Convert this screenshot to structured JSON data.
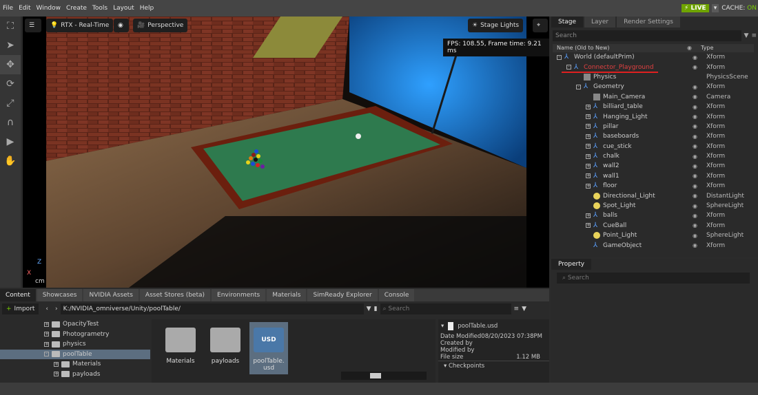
{
  "menu": [
    "File",
    "Edit",
    "Window",
    "Create",
    "Tools",
    "Layout",
    "Help"
  ],
  "live_label": "LIVE",
  "cache_prefix": "CACHE:",
  "cache_state": "ON",
  "viewport": {
    "render_mode": "RTX - Real-Time",
    "camera": "Perspective",
    "lights": "Stage Lights",
    "fps_text": "FPS: 108.55, Frame time: 9.21 ms",
    "units": "cm",
    "axis_x": "X",
    "axis_z": "Z"
  },
  "stage": {
    "tabs": [
      "Stage",
      "Layer",
      "Render Settings"
    ],
    "search_placeholder": "Search",
    "col_name": "Name (Old to New)",
    "col_type": "Type",
    "rows": [
      {
        "name": "World (defaultPrim)",
        "type": "Xform",
        "indent": 0,
        "icon": "xform-icon",
        "exp": "-",
        "eye": true
      },
      {
        "name": "Connector_Playground",
        "type": "Xform",
        "indent": 1,
        "icon": "xform-icon",
        "exp": "-",
        "eye": true
      },
      {
        "name": "Physics",
        "type": "PhysicsScene",
        "indent": 2,
        "icon": "physics-icon",
        "exp": "",
        "eye": false
      },
      {
        "name": "Geometry",
        "type": "Xform",
        "indent": 2,
        "icon": "xform-icon",
        "exp": "-",
        "eye": true
      },
      {
        "name": "Main_Camera",
        "type": "Camera",
        "indent": 3,
        "icon": "camera-icon",
        "exp": "",
        "eye": true
      },
      {
        "name": "billiard_table",
        "type": "Xform",
        "indent": 3,
        "icon": "xform-icon",
        "exp": "+",
        "eye": true
      },
      {
        "name": "Hanging_Light",
        "type": "Xform",
        "indent": 3,
        "icon": "xform-icon",
        "exp": "+",
        "eye": true
      },
      {
        "name": "pillar",
        "type": "Xform",
        "indent": 3,
        "icon": "xform-icon",
        "exp": "+",
        "eye": true
      },
      {
        "name": "baseboards",
        "type": "Xform",
        "indent": 3,
        "icon": "xform-icon",
        "exp": "+",
        "eye": true
      },
      {
        "name": "cue_stick",
        "type": "Xform",
        "indent": 3,
        "icon": "xform-icon",
        "exp": "+",
        "eye": true
      },
      {
        "name": "chalk",
        "type": "Xform",
        "indent": 3,
        "icon": "xform-icon",
        "exp": "+",
        "eye": true
      },
      {
        "name": "wall2",
        "type": "Xform",
        "indent": 3,
        "icon": "xform-icon",
        "exp": "+",
        "eye": true
      },
      {
        "name": "wall1",
        "type": "Xform",
        "indent": 3,
        "icon": "xform-icon",
        "exp": "+",
        "eye": true
      },
      {
        "name": "floor",
        "type": "Xform",
        "indent": 3,
        "icon": "xform-icon",
        "exp": "+",
        "eye": true
      },
      {
        "name": "Directional_Light",
        "type": "DistantLight",
        "indent": 3,
        "icon": "light-icon",
        "exp": "",
        "eye": true
      },
      {
        "name": "Spot_Light",
        "type": "SphereLight",
        "indent": 3,
        "icon": "light-icon",
        "exp": "",
        "eye": true
      },
      {
        "name": "balls",
        "type": "Xform",
        "indent": 3,
        "icon": "xform-icon",
        "exp": "+",
        "eye": true
      },
      {
        "name": "CueBall",
        "type": "Xform",
        "indent": 3,
        "icon": "xform-icon",
        "exp": "+",
        "eye": true
      },
      {
        "name": "Point_Light",
        "type": "SphereLight",
        "indent": 3,
        "icon": "light-icon",
        "exp": "",
        "eye": true
      },
      {
        "name": "GameObject",
        "type": "Xform",
        "indent": 3,
        "icon": "xform-icon",
        "exp": "",
        "eye": true
      }
    ]
  },
  "property": {
    "tab": "Property",
    "search_placeholder": "Search"
  },
  "content": {
    "tabs": [
      "Content",
      "Showcases",
      "NVIDIA Assets",
      "Asset Stores (beta)",
      "Environments",
      "Materials",
      "SimReady Explorer",
      "Console"
    ],
    "import_label": "Import",
    "path": "K:/NVIDIA_omniverse/Unity/poolTable/",
    "search_placeholder": "Search",
    "tree": [
      {
        "name": "OpacityTest",
        "indent": 0
      },
      {
        "name": "Photogrametry",
        "indent": 0
      },
      {
        "name": "physics",
        "indent": 0
      },
      {
        "name": "poolTable",
        "indent": 0,
        "selected": true
      },
      {
        "name": "Materials",
        "indent": 1
      },
      {
        "name": "payloads",
        "indent": 1
      }
    ],
    "files": [
      {
        "name": "Materials",
        "kind": "folder"
      },
      {
        "name": "payloads",
        "kind": "folder"
      },
      {
        "name": "poolTable.\nusd",
        "kind": "usd"
      }
    ],
    "usd_badge": "USD",
    "details": {
      "file": "poolTable.usd",
      "date_label": "Date Modified",
      "date_value": "08/20/2023 07:38PM",
      "created_label": "Created by",
      "modified_label": "Modified by",
      "size_label": "File size",
      "size_value": "1.12 MB",
      "checkpoints": "Checkpoints"
    }
  },
  "colors": {
    "accent_green": "#7ad000",
    "xform_blue": "#5aa0ff",
    "light_yellow": "#e8d25a",
    "underline_red": "#e02020"
  }
}
